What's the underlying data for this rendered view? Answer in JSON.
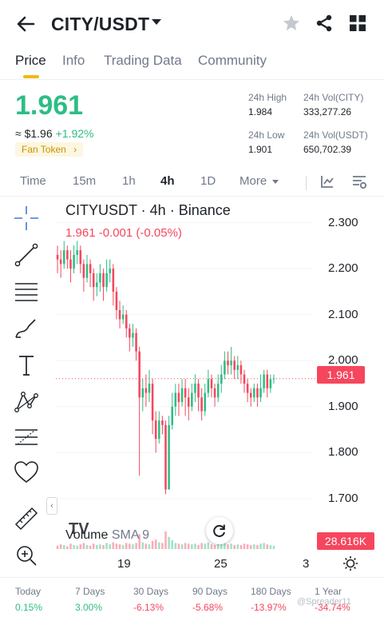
{
  "header": {
    "pair": "CITY/USDT"
  },
  "tabs": [
    {
      "label": "Price"
    },
    {
      "label": "Info"
    },
    {
      "label": "Trading Data"
    },
    {
      "label": "Community"
    }
  ],
  "ticker": {
    "price": "1.961",
    "usd_price": "≈ $1.96",
    "change_pct": "+1.92%",
    "badge": "Fan Token",
    "high_label": "24h High",
    "high_value": "1.984",
    "low_label": "24h Low",
    "low_value": "1.901",
    "vol_base_label": "24h Vol(CITY)",
    "vol_base_value": "333,277.26",
    "vol_quote_label": "24h Vol(USDT)",
    "vol_quote_value": "650,702.39"
  },
  "intervals": [
    {
      "label": "Time"
    },
    {
      "label": "15m"
    },
    {
      "label": "1h"
    },
    {
      "label": "4h"
    },
    {
      "label": "1D"
    },
    {
      "label": "More"
    }
  ],
  "chart": {
    "title": "CITYUSDT · 4h · Binance",
    "ohlc": "1.961  -0.001 (-0.05%)",
    "last_price_tag": "1.961",
    "volume_label": "Volume",
    "volume_sma": "SMA 9",
    "volume_tag": "28.616K",
    "tv_mark": "TV"
  },
  "chart_data": {
    "type": "candlestick",
    "title": "CITYUSDT · 4h · Binance",
    "y_ticks": [
      "2.300",
      "2.200",
      "2.100",
      "2.000",
      "1.900",
      "1.800",
      "1.700"
    ],
    "ylim": [
      1.66,
      2.32
    ],
    "x_ticks": [
      "19",
      "25",
      "3"
    ],
    "last_price": 1.961,
    "colors": {
      "up": "#2ebd85",
      "down": "#f6465d"
    },
    "candles": [
      [
        2.23,
        2.22,
        2.25,
        2.19
      ],
      [
        2.22,
        2.21,
        2.24,
        2.18
      ],
      [
        2.21,
        2.24,
        2.26,
        2.2
      ],
      [
        2.24,
        2.22,
        2.25,
        2.2
      ],
      [
        2.22,
        2.2,
        2.24,
        2.17
      ],
      [
        2.2,
        2.23,
        2.25,
        2.19
      ],
      [
        2.23,
        2.24,
        2.26,
        2.21
      ],
      [
        2.24,
        2.21,
        2.25,
        2.19
      ],
      [
        2.21,
        2.18,
        2.22,
        2.15
      ],
      [
        2.18,
        2.21,
        2.23,
        2.17
      ],
      [
        2.21,
        2.19,
        2.22,
        2.16
      ],
      [
        2.19,
        2.16,
        2.2,
        2.13
      ],
      [
        2.16,
        2.17,
        2.19,
        2.14
      ],
      [
        2.17,
        2.19,
        2.21,
        2.15
      ],
      [
        2.19,
        2.16,
        2.2,
        2.13
      ],
      [
        2.16,
        2.19,
        2.22,
        2.15
      ],
      [
        2.19,
        2.2,
        2.22,
        2.17
      ],
      [
        2.2,
        2.15,
        2.21,
        2.12
      ],
      [
        2.15,
        2.11,
        2.16,
        2.09
      ],
      [
        2.11,
        2.09,
        2.13,
        2.07
      ],
      [
        2.09,
        2.1,
        2.12,
        2.08
      ],
      [
        2.1,
        2.07,
        2.11,
        2.05
      ],
      [
        2.07,
        2.05,
        2.08,
        2.02
      ],
      [
        2.05,
        2.06,
        2.08,
        2.03
      ],
      [
        2.06,
        2.02,
        2.07,
        2.0
      ],
      [
        2.02,
        1.92,
        2.03,
        1.75
      ],
      [
        1.92,
        1.94,
        1.96,
        1.89
      ],
      [
        1.94,
        1.93,
        1.97,
        1.9
      ],
      [
        1.93,
        1.95,
        1.98,
        1.91
      ],
      [
        1.95,
        1.87,
        1.96,
        1.84
      ],
      [
        1.87,
        1.83,
        1.89,
        1.8
      ],
      [
        1.83,
        1.87,
        1.89,
        1.82
      ],
      [
        1.87,
        1.86,
        1.88,
        1.84
      ],
      [
        1.86,
        1.72,
        1.87,
        1.71
      ],
      [
        1.72,
        1.86,
        1.88,
        1.72
      ],
      [
        1.86,
        1.9,
        1.93,
        1.85
      ],
      [
        1.9,
        1.93,
        1.95,
        1.88
      ],
      [
        1.93,
        1.91,
        1.95,
        1.88
      ],
      [
        1.91,
        1.94,
        1.96,
        1.9
      ],
      [
        1.94,
        1.92,
        1.96,
        1.88
      ],
      [
        1.92,
        1.9,
        1.94,
        1.87
      ],
      [
        1.9,
        1.93,
        1.95,
        1.89
      ],
      [
        1.93,
        1.95,
        1.97,
        1.91
      ],
      [
        1.95,
        1.92,
        1.96,
        1.89
      ],
      [
        1.92,
        1.89,
        1.94,
        1.87
      ],
      [
        1.89,
        1.93,
        1.95,
        1.88
      ],
      [
        1.93,
        1.96,
        1.98,
        1.92
      ],
      [
        1.96,
        1.94,
        1.97,
        1.92
      ],
      [
        1.94,
        1.92,
        1.95,
        1.9
      ],
      [
        1.92,
        1.95,
        1.97,
        1.91
      ],
      [
        1.95,
        1.97,
        1.99,
        1.93
      ],
      [
        1.97,
        2.0,
        2.02,
        1.96
      ],
      [
        2.0,
        1.99,
        2.02,
        1.97
      ],
      [
        1.99,
        2.0,
        2.03,
        1.97
      ],
      [
        2.0,
        1.98,
        2.01,
        1.96
      ],
      [
        1.98,
        1.99,
        2.01,
        1.96
      ],
      [
        1.99,
        1.97,
        2.0,
        1.95
      ],
      [
        1.97,
        1.95,
        1.98,
        1.93
      ],
      [
        1.95,
        1.93,
        1.96,
        1.91
      ],
      [
        1.93,
        1.92,
        1.94,
        1.9
      ],
      [
        1.92,
        1.94,
        1.95,
        1.91
      ],
      [
        1.94,
        1.92,
        1.95,
        1.9
      ],
      [
        1.92,
        1.94,
        1.97,
        1.91
      ],
      [
        1.94,
        1.97,
        1.98,
        1.93
      ],
      [
        1.97,
        1.94,
        1.98,
        1.92
      ],
      [
        1.94,
        1.96,
        1.97,
        1.93
      ],
      [
        1.96,
        1.961,
        1.97,
        1.95
      ]
    ],
    "volumes": [
      5,
      7,
      6,
      4,
      8,
      6,
      5,
      7,
      9,
      6,
      5,
      8,
      6,
      7,
      6,
      9,
      7,
      10,
      8,
      7,
      6,
      9,
      8,
      7,
      9,
      22,
      10,
      8,
      7,
      12,
      14,
      10,
      9,
      26,
      18,
      13,
      9,
      8,
      7,
      9,
      8,
      7,
      8,
      6,
      9,
      8,
      10,
      7,
      6,
      9,
      8,
      11,
      7,
      8,
      6,
      7,
      6,
      8,
      7,
      6,
      7,
      6,
      8,
      9,
      7,
      6,
      5
    ]
  },
  "performance": [
    {
      "label": "Today",
      "value": "0.15%",
      "dir": "up"
    },
    {
      "label": "7 Days",
      "value": "3.00%",
      "dir": "up"
    },
    {
      "label": "30 Days",
      "value": "-6.13%",
      "dir": "down"
    },
    {
      "label": "90 Days",
      "value": "-5.68%",
      "dir": "down"
    },
    {
      "label": "180 Days",
      "value": "-13.97%",
      "dir": "down"
    },
    {
      "label": "1 Year",
      "value": "-34.74%",
      "dir": "down"
    }
  ],
  "watermark": "@Spreader11"
}
